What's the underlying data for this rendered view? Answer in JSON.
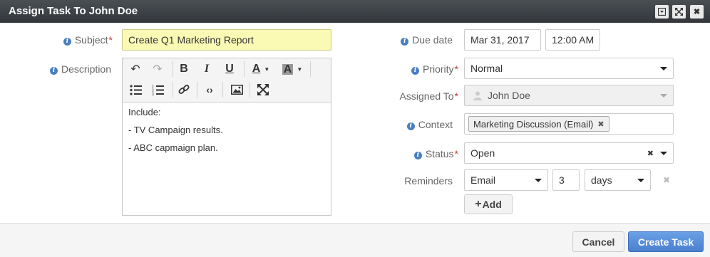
{
  "dialog": {
    "title": "Assign Task To John Doe",
    "controls": {
      "minimize_icon": "minimize-icon",
      "maximize_icon": "expand-icon",
      "close_icon": "close-icon"
    }
  },
  "form": {
    "subject": {
      "label": "Subject",
      "value": "Create Q1 Marketing Report"
    },
    "description": {
      "label": "Description",
      "lines": [
        "Include:",
        "- TV Campaign results.",
        "- ABC capmaign plan."
      ]
    },
    "due_date": {
      "label": "Due date",
      "date": "Mar 31, 2017",
      "time": "12:00 AM"
    },
    "priority": {
      "label": "Priority",
      "value": "Normal"
    },
    "assigned_to": {
      "label": "Assigned To",
      "value": "John Doe"
    },
    "context": {
      "label": "Context",
      "chip": "Marketing Discussion (Email)",
      "chip_remove": "✖"
    },
    "status": {
      "label": "Status",
      "value": "Open",
      "clear": "✖"
    },
    "reminders": {
      "label": "Reminders",
      "type": "Email",
      "amount": "3",
      "unit": "days",
      "remove": "✖",
      "add_label": "Add",
      "add_plus": "+"
    }
  },
  "footer": {
    "cancel_label": "Cancel",
    "create_label": "Create Task"
  },
  "colors": {
    "title_bar": "#3b3f43",
    "subject_bg": "#fafab5",
    "primary": "#5a8fdb",
    "info_icon": "#4a7fc1",
    "required": "#c0392b"
  }
}
